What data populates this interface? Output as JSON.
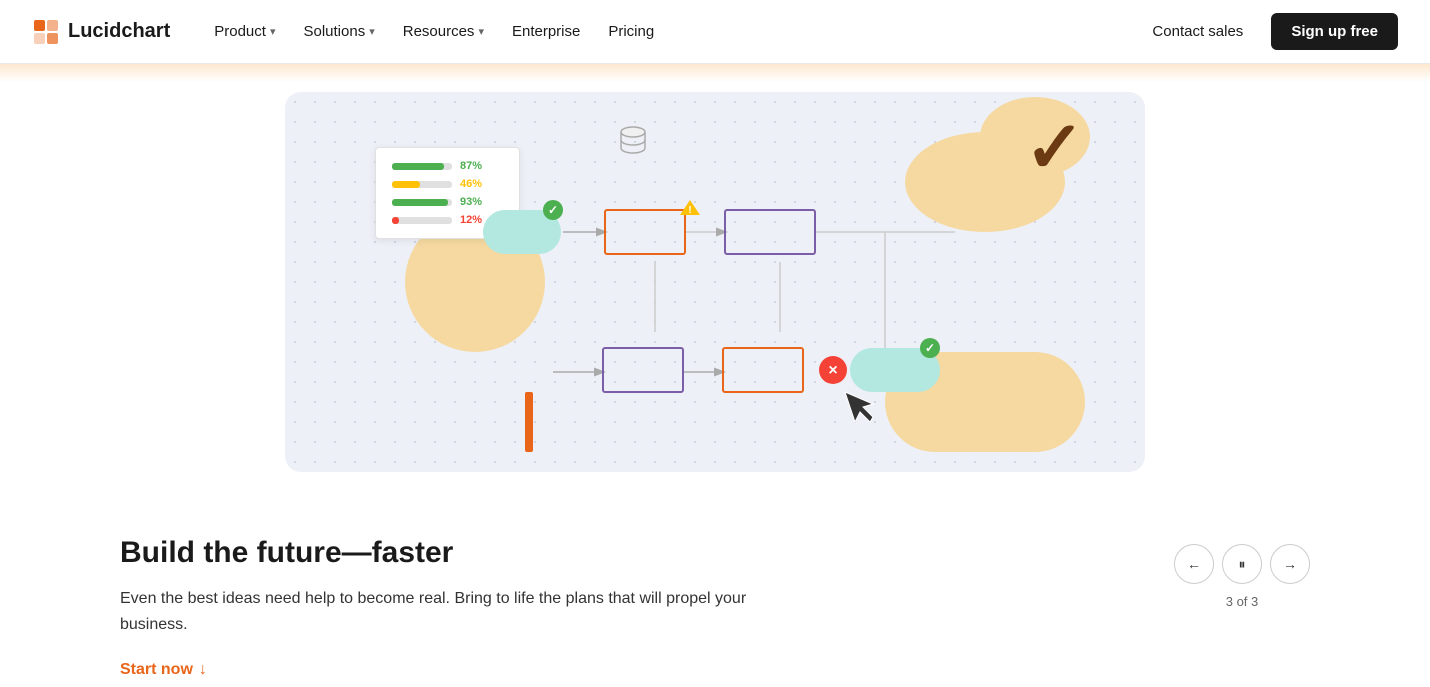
{
  "navbar": {
    "logo_text": "Lucidchart",
    "nav_items": [
      {
        "label": "Product",
        "has_dropdown": true
      },
      {
        "label": "Solutions",
        "has_dropdown": true
      },
      {
        "label": "Resources",
        "has_dropdown": true
      },
      {
        "label": "Enterprise",
        "has_dropdown": false
      },
      {
        "label": "Pricing",
        "has_dropdown": false
      }
    ],
    "contact_sales": "Contact sales",
    "signup": "Sign up free"
  },
  "hero": {
    "heading": "Build the future—faster",
    "subtext": "Even the best ideas need help to become real. Bring to life the plans that will propel your business.",
    "cta_label": "Start now",
    "cta_arrow": "↓"
  },
  "data_widget": {
    "rows": [
      {
        "pct": "87%",
        "fill_width": 52,
        "color": "green"
      },
      {
        "pct": "46%",
        "fill_width": 28,
        "color": "yellow"
      },
      {
        "pct": "93%",
        "fill_width": 56,
        "color": "green"
      },
      {
        "pct": "12%",
        "fill_width": 7,
        "color": "red"
      }
    ]
  },
  "pagination": {
    "current": 3,
    "total": 3,
    "label": "3 of 3",
    "prev_icon": "←",
    "pause_icon": "⏸",
    "next_icon": "→"
  },
  "icons": {
    "database": "🗄",
    "logo_shape": "◧"
  }
}
